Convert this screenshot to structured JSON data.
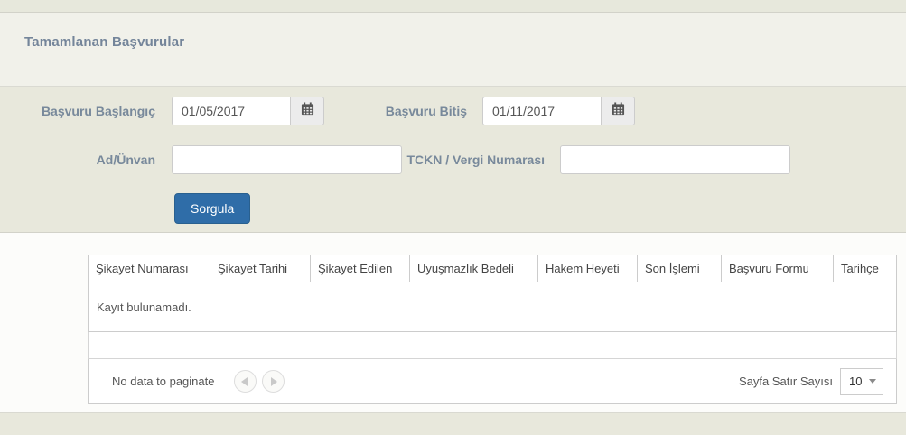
{
  "page": {
    "title": "Tamamlanan Başvurular"
  },
  "form": {
    "fields": [
      {
        "label": "Başvuru Başlangıç",
        "value": "01/05/2017",
        "type": "date"
      },
      {
        "label": "Başvuru Bitiş",
        "value": "01/11/2017",
        "type": "date"
      },
      {
        "label": "Ad/Ünvan",
        "value": "",
        "type": "text"
      },
      {
        "label": "TCKN / Vergi Numarası",
        "value": "",
        "type": "text"
      }
    ],
    "submit_label": "Sorgula"
  },
  "table": {
    "columns": [
      "Şikayet Numarası",
      "Şikayet Tarihi",
      "Şikayet Edilen",
      "Uyuşmazlık Bedeli",
      "Hakem Heyeti",
      "Son İşlemi",
      "Başvuru Formu",
      "Tarihçe"
    ],
    "empty_message": "Kayıt bulunamadı.",
    "pagination": {
      "status": "No data to paginate",
      "page_size_label": "Sayfa Satır Sayısı",
      "page_size_value": "10"
    }
  },
  "icons": {
    "calendar": "calendar-icon",
    "prev": "prev-page-icon",
    "next": "next-page-icon",
    "caret": "dropdown-caret-icon"
  },
  "colors": {
    "button_bg": "#2f6da8",
    "button_border": "#29608f",
    "label_text": "#78899b",
    "title_text": "#74859a",
    "section_beige": "#e8e8dc",
    "header_beige": "#f1f1ea",
    "table_border": "#cccccc"
  }
}
